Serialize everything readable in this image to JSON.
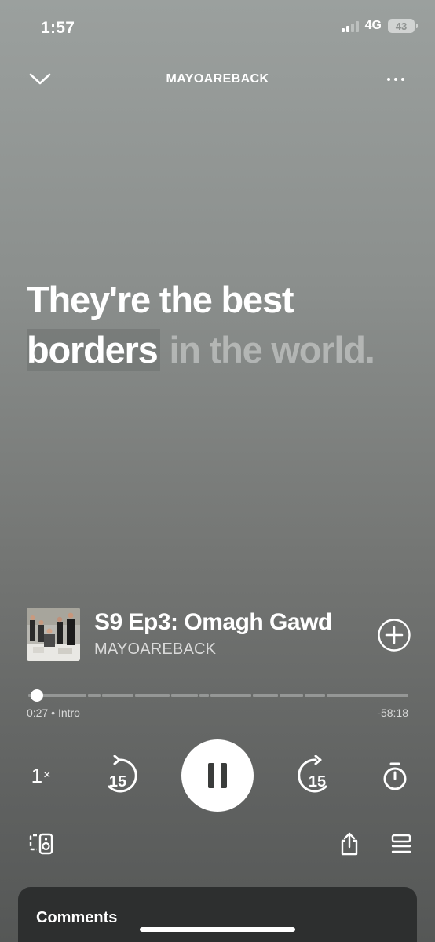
{
  "status_bar": {
    "time": "1:57",
    "network": "4G",
    "battery": "43"
  },
  "header": {
    "title": "MAYOAREBACK",
    "collapse_icon": "chevron-down-icon",
    "more_icon": "more-dots-icon"
  },
  "lyrics": {
    "line1": "They're the best",
    "active_word": "borders",
    "upcoming": " in the world."
  },
  "track": {
    "title": "S9 Ep3: Omagh Gawd",
    "artist": "MAYOAREBACK"
  },
  "playback": {
    "elapsed": "0:27",
    "chapter": "Intro",
    "remaining": "-58:18",
    "progress_fraction": 0.0077
  },
  "controls": {
    "speed": "1",
    "speed_suffix": "×",
    "skip_back_seconds": "15",
    "skip_forward_seconds": "15",
    "play_state": "playing"
  },
  "comments": {
    "title": "Comments"
  },
  "colors": {
    "accent": "#ffffff",
    "highlight": "#6e7170"
  }
}
